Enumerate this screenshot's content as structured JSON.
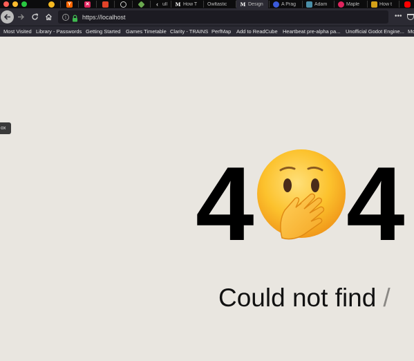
{
  "tabs": [
    {
      "label": "",
      "icon": "chat-bubble-icon",
      "color": "#f5b921"
    },
    {
      "label": "",
      "icon": "y-combinator-icon",
      "color": "#ff6600"
    },
    {
      "label": "",
      "icon": "clarity-icon",
      "color": "#e0245e"
    },
    {
      "label": "",
      "icon": "gitlab-fox-icon",
      "color": "#e24329"
    },
    {
      "label": "",
      "icon": "globe-icon",
      "color": "#cfcfcf"
    },
    {
      "label": "",
      "icon": "godot-diamond-icon",
      "color": "#6aa84f"
    },
    {
      "label": "ull",
      "icon": "back-chevron-icon",
      "color": "#cfcfcf"
    },
    {
      "label": "How T",
      "icon": "medium-icon",
      "color": "#ffffff"
    },
    {
      "label": "Owltastic",
      "icon": "owl-icon",
      "color": "#888888"
    },
    {
      "label": "Design",
      "icon": "medium-icon",
      "color": "#ffffff"
    },
    {
      "label": "A Prag",
      "icon": "circle-icon",
      "color": "#3b5bdb"
    },
    {
      "label": "Adam",
      "icon": "adam-icon",
      "color": "#4a8fa8"
    },
    {
      "label": "Maple",
      "icon": "maple-icon",
      "color": "#e0245e"
    },
    {
      "label": "How t",
      "icon": "doc-icon",
      "color": "#d4a017"
    },
    {
      "label": "",
      "icon": "youtube-icon",
      "color": "#ff0000"
    }
  ],
  "nav": {
    "url": "https://localhost"
  },
  "bookmarks": [
    "Most Visited",
    "Library - Passwords",
    "Getting Started",
    "Games Timetable",
    "Clarity - TRAINS",
    "PerfMap",
    "Add to ReadCube",
    "Heartbeat pre-alpha pa...",
    "Unofficial Godot Engine...",
    "Mo"
  ],
  "page": {
    "side_tab": "ox",
    "digit_left": "4",
    "digit_right": "4",
    "emoji": "face-with-hand-over-mouth",
    "message": "Could not find",
    "path": "/"
  },
  "colors": {
    "page_bg": "#e9e6e0",
    "chrome_bg": "#2b2a33",
    "tabstrip_bg": "#0c0c0d",
    "lock_green": "#3fb950"
  }
}
